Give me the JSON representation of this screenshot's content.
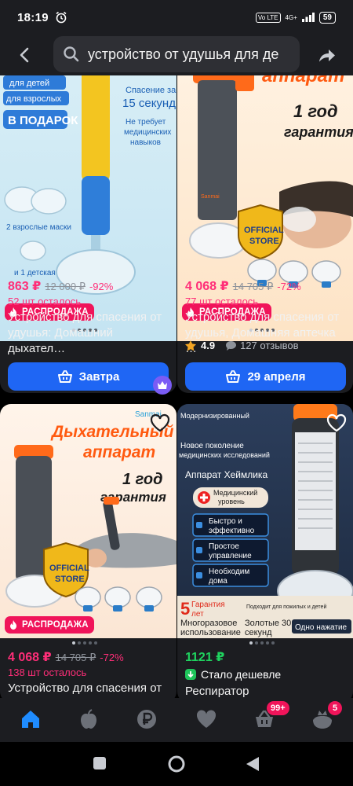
{
  "status_bar": {
    "time": "18:19",
    "volte": "Vo LTE",
    "network": "4G+",
    "battery": "59"
  },
  "search": {
    "query": "устройство от удушья для де"
  },
  "products": [
    {
      "sale": "РАСПРОДАЖА",
      "price": "863 ₽",
      "old_price": "12 000 ₽",
      "discount": "-92%",
      "stock": "52 шт осталось",
      "title": "Устройство для спасения от удушья: Домашний дыхател…",
      "button": "Завтра",
      "image_text": [
        "для детей",
        "для взрослых",
        "Спасение за",
        "15 секунд",
        "Не требует",
        "медицинских",
        "навыков",
        "В ПОДАРОК",
        "2 взрослые маски",
        "и 1 детская"
      ]
    },
    {
      "sale": "РАСПРОДАЖА",
      "price": "4 068 ₽",
      "old_price": "14 705 ₽",
      "discount": "-72%",
      "stock": "77 шт осталось",
      "title": "Устройство для спасения от удушья, Домашняя аптечка …",
      "rating": "4.9",
      "reviews": "127 отзывов",
      "button": "29 апреля",
      "image_text": [
        "аппарат",
        "1 год",
        "гарантия",
        "OFFICIAL",
        "STORE",
        "Sanmai"
      ]
    },
    {
      "sale": "РАСПРОДАЖА",
      "price": "4 068 ₽",
      "old_price": "14 705 ₽",
      "discount": "-72%",
      "stock": "138 шт осталось",
      "title": "Устройство для спасения от",
      "image_text": [
        "Sanmai",
        "Дыхательный",
        "аппарат",
        "1 год",
        "гарантия",
        "OFFICIAL",
        "STORE"
      ]
    },
    {
      "price": "1121 ₽",
      "cheaper": "Стало дешевле",
      "title": "Респиратор",
      "image_text": [
        "Модернизированный",
        "Новое поколение",
        "медицинских исследований",
        "Аппарат Хеймлика",
        "Медицинский",
        "уровень",
        "Быстро и",
        "эффективно",
        "Простое",
        "управление",
        "Необходим",
        "дома",
        "5",
        "Гарантия",
        "лет",
        "Многоразовое",
        "использование",
        "Подходит для пожилых и детей",
        "Золотые 30",
        "секунд",
        "Одно нажатие"
      ]
    }
  ],
  "bottom_nav": {
    "cart_badge": "99+",
    "profile_badge": "5"
  },
  "colors": {
    "accent": "#1f66f4",
    "sale": "#f0145a",
    "price": "#ff2e78",
    "green": "#1fd35f"
  }
}
